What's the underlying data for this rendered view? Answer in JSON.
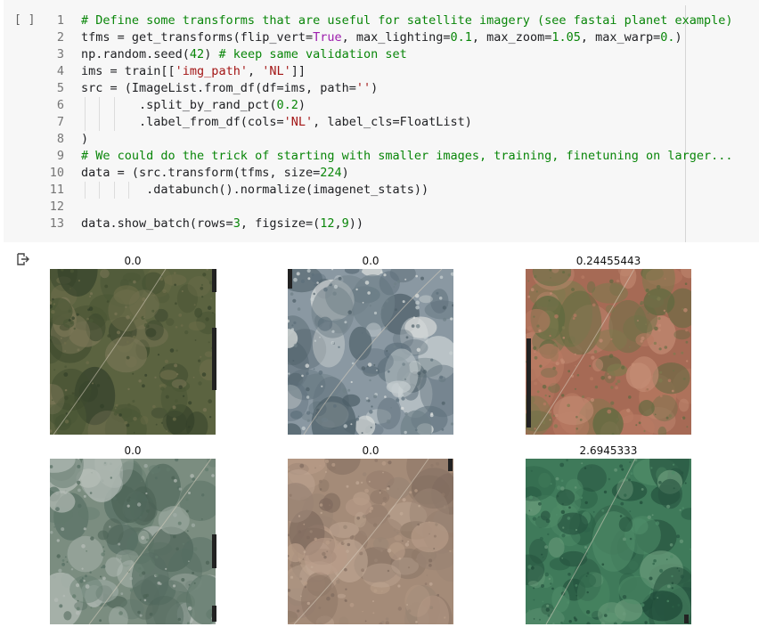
{
  "cell": {
    "run_label": "[ ]",
    "lines": [
      {
        "n": "1",
        "tokens": [
          {
            "t": "# Define some transforms that are useful for satellite imagery (see fastai planet example)",
            "c": "t-com"
          }
        ]
      },
      {
        "n": "2",
        "tokens": [
          {
            "t": "tfms = get_transforms(flip_vert="
          },
          {
            "t": "True",
            "c": "t-kw"
          },
          {
            "t": ", max_lighting="
          },
          {
            "t": "0.1",
            "c": "t-num"
          },
          {
            "t": ", max_zoom="
          },
          {
            "t": "1.05",
            "c": "t-num"
          },
          {
            "t": ", max_warp="
          },
          {
            "t": "0.",
            "c": "t-num"
          },
          {
            "t": ")"
          }
        ]
      },
      {
        "n": "3",
        "tokens": [
          {
            "t": "np.random.seed("
          },
          {
            "t": "42",
            "c": "t-num"
          },
          {
            "t": ") "
          },
          {
            "t": "# keep same validation set",
            "c": "t-com"
          }
        ]
      },
      {
        "n": "4",
        "tokens": [
          {
            "t": "ims = train[["
          },
          {
            "t": "'img_path'",
            "c": "t-str"
          },
          {
            "t": ", "
          },
          {
            "t": "'NL'",
            "c": "t-str"
          },
          {
            "t": "]]"
          }
        ]
      },
      {
        "n": "5",
        "tokens": [
          {
            "t": "src = (ImageList.from_df(df=ims, path="
          },
          {
            "t": "''",
            "c": "t-str"
          },
          {
            "t": ")"
          }
        ]
      },
      {
        "n": "6",
        "tokens": [
          {
            "t": "        .split_by_rand_pct("
          },
          {
            "t": "0.2",
            "c": "t-num"
          },
          {
            "t": ")"
          }
        ]
      },
      {
        "n": "7",
        "tokens": [
          {
            "t": "        .label_from_df(cols="
          },
          {
            "t": "'NL'",
            "c": "t-str"
          },
          {
            "t": ", label_cls=FloatList)"
          }
        ]
      },
      {
        "n": "8",
        "tokens": [
          {
            "t": ")"
          }
        ]
      },
      {
        "n": "9",
        "tokens": [
          {
            "t": "# We could do the trick of starting with smaller images, training, finetuning on larger...",
            "c": "t-com"
          }
        ]
      },
      {
        "n": "10",
        "tokens": [
          {
            "t": "data = (src.transform(tfms, size="
          },
          {
            "t": "224",
            "c": "t-num"
          },
          {
            "t": ")"
          }
        ]
      },
      {
        "n": "11",
        "tokens": [
          {
            "t": "         .databunch().normalize(imagenet_stats))"
          }
        ]
      },
      {
        "n": "12",
        "tokens": [
          {
            "t": ""
          }
        ]
      },
      {
        "n": "13",
        "tokens": [
          {
            "t": "data.show_batch(rows="
          },
          {
            "t": "3",
            "c": "t-num"
          },
          {
            "t": ", figsize=("
          },
          {
            "t": "12",
            "c": "t-num"
          },
          {
            "t": ","
          },
          {
            "t": "9",
            "c": "t-num"
          },
          {
            "t": "))"
          }
        ]
      }
    ]
  },
  "output": {
    "icon": "output-redirect-icon",
    "tiles": [
      {
        "title": "0.0",
        "palette": "dark-green"
      },
      {
        "title": "0.0",
        "palette": "blue-grey"
      },
      {
        "title": "0.24455443",
        "palette": "red-earth"
      },
      {
        "title": "0.0",
        "palette": "grey-green"
      },
      {
        "title": "0.0",
        "palette": "tan"
      },
      {
        "title": "2.6945333",
        "palette": "bright-green"
      }
    ]
  },
  "colors": {
    "comment": "#098609",
    "number": "#098609",
    "string": "#a31515",
    "keyword": "#9d1ead",
    "cell_bg": "#f7f7f7"
  }
}
